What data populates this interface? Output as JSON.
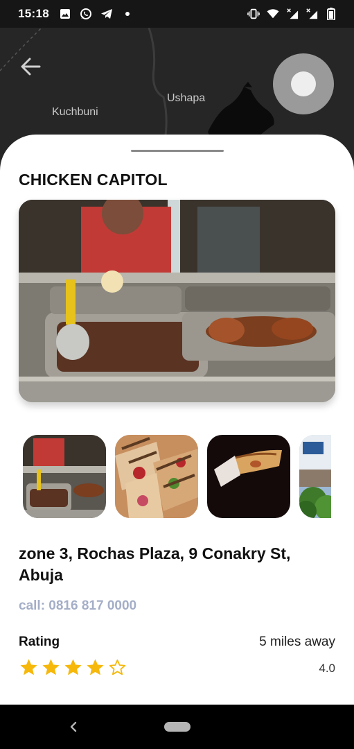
{
  "status_bar": {
    "time": "15:18",
    "left_icons": [
      "image-icon",
      "whatsapp-icon",
      "telegram-icon",
      "dot-icon"
    ],
    "right_icons": [
      "vibrate-icon",
      "wifi-icon",
      "signal-x-icon",
      "signal-x-icon",
      "battery-icon"
    ]
  },
  "map": {
    "labels": [
      "Kuchbuni",
      "Ushapa"
    ]
  },
  "place": {
    "title": "CHICKEN CAPITOL",
    "address": "zone 3, Rochas Plaza, 9 Conakry St, Abuja",
    "phone": "call: 0816 817 0000",
    "rating_label": "Rating",
    "distance": "5 miles away",
    "rating_value": "4.0",
    "stars_filled": 4,
    "stars_total": 5
  },
  "thumbnails": [
    "buffet-photo",
    "wraps-photo",
    "wrap-in-hand-photo",
    "street-photo"
  ],
  "colors": {
    "star": "#F6B80B",
    "phone_text": "#A4AEC7",
    "sheet_bg": "#FFFFFF"
  }
}
